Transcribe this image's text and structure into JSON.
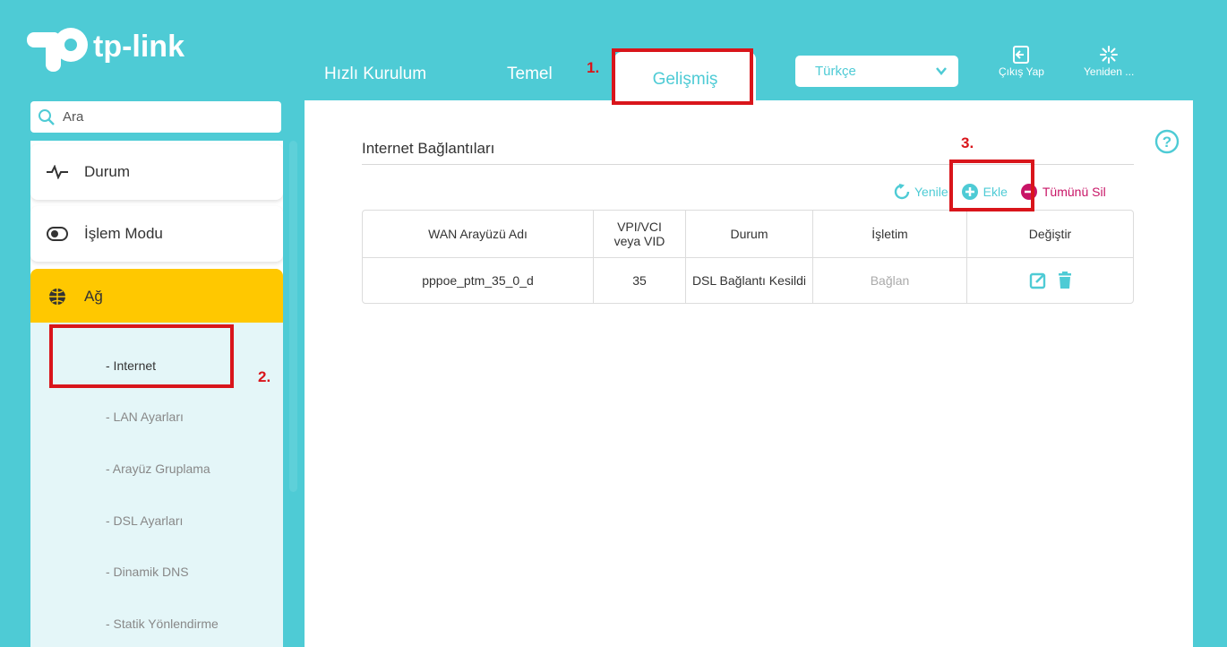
{
  "brand": {
    "logo_text": "tp-link"
  },
  "nav": {
    "tabs": [
      {
        "label": "Hızlı Kurulum"
      },
      {
        "label": "Temel"
      },
      {
        "label": "Gelişmiş",
        "active": true
      }
    ]
  },
  "language": {
    "selected": "Türkçe"
  },
  "header_buttons": {
    "logout": "Çıkış Yap",
    "reboot": "Yeniden ..."
  },
  "sidebar": {
    "search_placeholder": "Ara",
    "items": [
      {
        "label": "Durum",
        "icon": "pulse-icon"
      },
      {
        "label": "İşlem Modu",
        "icon": "toggle-icon"
      },
      {
        "label": "Ağ",
        "icon": "globe-icon",
        "active": true
      }
    ],
    "subitems": [
      {
        "label": "- Internet",
        "active": true
      },
      {
        "label": "- LAN Ayarları"
      },
      {
        "label": "- Arayüz Gruplama"
      },
      {
        "label": "- DSL Ayarları"
      },
      {
        "label": "- Dinamik DNS"
      },
      {
        "label": "- Statik Yönlendirme"
      }
    ]
  },
  "main": {
    "title": "Internet Bağlantıları",
    "actions": {
      "refresh": "Yenile",
      "add": "Ekle",
      "delete_all": "Tümünü Sil"
    },
    "table": {
      "headers": [
        "WAN Arayüzü Adı",
        "VPI/VCI veya VID",
        "Durum",
        "İşletim",
        "Değiştir"
      ],
      "rows": [
        {
          "name": "pppoe_ptm_35_0_d",
          "vpi": "35",
          "status": "DSL Bağlantı Kesildi",
          "operation": "Bağlan"
        }
      ]
    }
  },
  "annotations": {
    "step1": "1.",
    "step2": "2.",
    "step3": "3."
  },
  "colors": {
    "teal": "#4ecbd5",
    "yellow": "#ffc800",
    "red": "#d9151b",
    "magenta": "#c81466"
  }
}
